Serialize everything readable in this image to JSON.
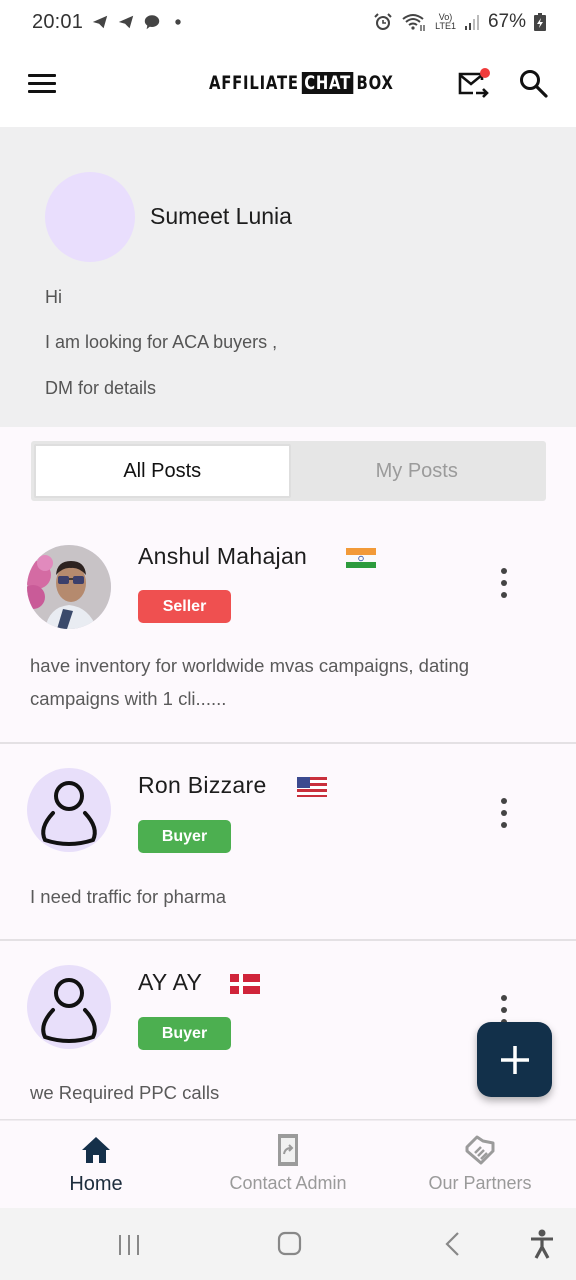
{
  "status_bar": {
    "time": "20:01",
    "left_icons": [
      "telegram-icon",
      "telegram-icon",
      "chat-bubble-icon",
      "dot-icon"
    ],
    "right_icons": [
      "alarm-icon",
      "wifi-icon",
      "volte-icon",
      "signal-icon",
      "battery-charging-icon"
    ],
    "volte_top": "Vo)",
    "volte_bottom": "LTE1",
    "battery": "67%"
  },
  "app_bar": {
    "logo_left": "AFFILIATE",
    "logo_mid": "CHAT",
    "logo_right": "BOX",
    "icons": [
      "menu-icon",
      "mail-notification-icon",
      "search-icon"
    ],
    "notification_color": "#f03a3a"
  },
  "profile": {
    "name": "Sumeet Lunia",
    "bio_lines": [
      "Hi",
      "I am looking for ACA buyers ,",
      "DM for details"
    ]
  },
  "tabs": [
    {
      "label": "All Posts",
      "active": true
    },
    {
      "label": "My Posts",
      "active": false
    }
  ],
  "posts": [
    {
      "name": "Anshul Mahajan",
      "country_flag": "india-flag",
      "role": "Seller",
      "avatar": "photo",
      "body": "have inventory for worldwide mvas campaigns, dating campaigns with 1 cli......"
    },
    {
      "name": "Ron Bizzare",
      "country_flag": "usa-flag",
      "role": "Buyer",
      "avatar": "default-person",
      "body": "I need traffic for pharma"
    },
    {
      "name": "AY AY",
      "country_flag": "denmark-flag",
      "role": "Buyer",
      "avatar": "default-person",
      "body": "we Required  PPC calls"
    }
  ],
  "fab": {
    "icon": "plus-icon",
    "color": "#12304a"
  },
  "bottom_nav": [
    {
      "label": "Home",
      "icon": "home-icon",
      "active": true
    },
    {
      "label": "Contact Admin",
      "icon": "phone-forward-icon",
      "active": false
    },
    {
      "label": "Our Partners",
      "icon": "handshake-icon",
      "active": false
    }
  ],
  "colors": {
    "seller": "#ef5050",
    "buyer": "#4caf50",
    "primary": "#12304a",
    "avatar_bg": "#e9defd"
  }
}
